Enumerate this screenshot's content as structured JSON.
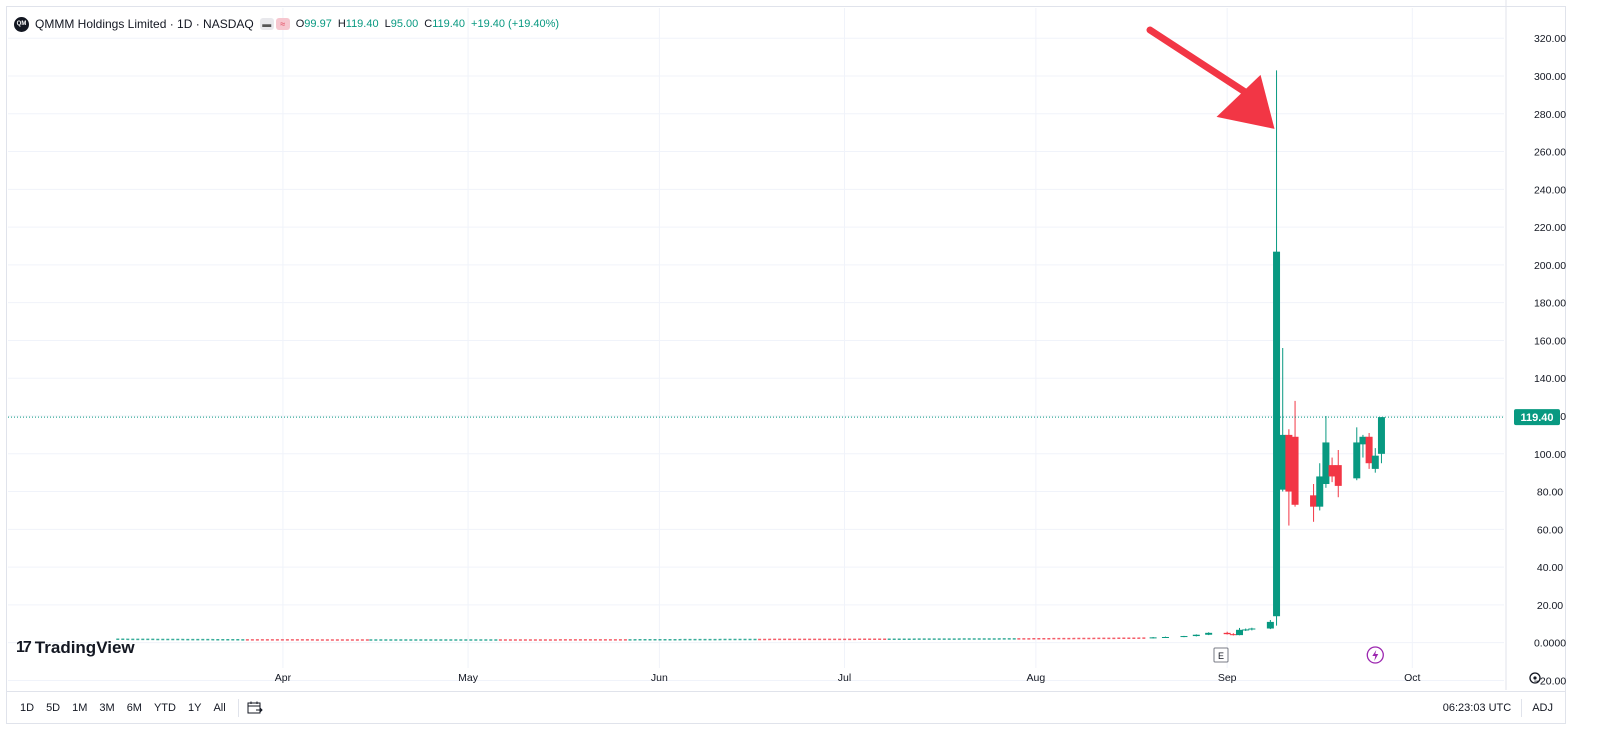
{
  "legend": {
    "logo_text": "QM",
    "title": "QMMM Holdings Limited · 1D · NASDAQ",
    "ohlc": [
      {
        "k": "O",
        "v": "99.97"
      },
      {
        "k": "H",
        "v": "119.40"
      },
      {
        "k": "L",
        "v": "95.00"
      },
      {
        "k": "C",
        "v": "119.40"
      },
      {
        "k": "",
        "v": "+19.40 (+19.40%)"
      }
    ]
  },
  "brand": {
    "name": "TradingView",
    "mark": "17"
  },
  "timeframes": [
    "1D",
    "5D",
    "1M",
    "3M",
    "6M",
    "YTD",
    "1Y",
    "All"
  ],
  "clock": "06:23:03 UTC",
  "adj": "ADJ",
  "markers": {
    "earnings": "E",
    "dividend_icon": "lightning-icon"
  },
  "colors": {
    "up": "#089981",
    "down": "#f23645",
    "annotation_arrow": "#f23645"
  },
  "chart_data": {
    "type": "candlestick",
    "symbol": "QMMM",
    "interval": "1D",
    "y_axis": {
      "ticks": [
        "320.00",
        "300.00",
        "280.00",
        "260.00",
        "240.00",
        "220.00",
        "200.00",
        "180.00",
        "160.00",
        "140.00",
        "120.00",
        "100.00",
        "80.00",
        "60.00",
        "40.00",
        "20.00",
        "0.0000",
        "−20.00"
      ],
      "range": [
        -24,
        336
      ],
      "position": "right"
    },
    "x_axis": {
      "ticks": [
        "Apr",
        "May",
        "Jun",
        "Jul",
        "Aug",
        "Sep",
        "Oct"
      ],
      "range": [
        "2025-03-15",
        "2025-10-05"
      ]
    },
    "last_price": {
      "value": 119.4,
      "label": "119.40"
    },
    "grid": true,
    "baseline": [
      {
        "d": "2025-03-05",
        "o": 1.8,
        "h": 2.0,
        "l": 1.6,
        "c": 1.8
      },
      {
        "d": "2025-03-26",
        "o": 1.6,
        "h": 1.8,
        "l": 1.4,
        "c": 1.5
      },
      {
        "d": "2025-04-15",
        "o": 1.4,
        "h": 1.6,
        "l": 1.3,
        "c": 1.4
      },
      {
        "d": "2025-05-06",
        "o": 1.3,
        "h": 1.5,
        "l": 1.2,
        "c": 1.4
      },
      {
        "d": "2025-05-27",
        "o": 1.4,
        "h": 1.6,
        "l": 1.3,
        "c": 1.5
      },
      {
        "d": "2025-06-17",
        "o": 1.5,
        "h": 1.7,
        "l": 1.4,
        "c": 1.7
      },
      {
        "d": "2025-07-08",
        "o": 1.7,
        "h": 1.9,
        "l": 1.6,
        "c": 1.8
      },
      {
        "d": "2025-07-29",
        "o": 1.8,
        "h": 2.1,
        "l": 1.7,
        "c": 2.0
      },
      {
        "d": "2025-08-19",
        "o": 2.0,
        "h": 2.5,
        "l": 1.9,
        "c": 2.4
      }
    ],
    "candles": [
      {
        "d": "2025-08-20",
        "o": 2.4,
        "h": 3.0,
        "l": 2.2,
        "c": 2.8
      },
      {
        "d": "2025-08-22",
        "o": 2.8,
        "h": 3.2,
        "l": 2.6,
        "c": 3.0
      },
      {
        "d": "2025-08-25",
        "o": 3.0,
        "h": 3.6,
        "l": 2.9,
        "c": 3.5
      },
      {
        "d": "2025-08-27",
        "o": 3.5,
        "h": 4.4,
        "l": 3.3,
        "c": 4.2
      },
      {
        "d": "2025-08-29",
        "o": 4.2,
        "h": 5.5,
        "l": 4.0,
        "c": 5.2
      },
      {
        "d": "2025-09-01",
        "o": 5.2,
        "h": 5.8,
        "l": 4.3,
        "c": 4.5
      },
      {
        "d": "2025-09-02",
        "o": 4.5,
        "h": 5.0,
        "l": 3.8,
        "c": 4.0
      },
      {
        "d": "2025-09-03",
        "o": 4.0,
        "h": 7.8,
        "l": 3.9,
        "c": 6.8
      },
      {
        "d": "2025-09-04",
        "o": 6.8,
        "h": 7.5,
        "l": 6.2,
        "c": 7.0
      },
      {
        "d": "2025-09-05",
        "o": 7.0,
        "h": 7.9,
        "l": 6.5,
        "c": 7.5
      },
      {
        "d": "2025-09-08",
        "o": 7.5,
        "h": 12.0,
        "l": 7.2,
        "c": 11.0
      },
      {
        "d": "2025-09-09",
        "o": 14.0,
        "h": 303.0,
        "l": 9.0,
        "c": 207.0
      },
      {
        "d": "2025-09-10",
        "o": 81.0,
        "h": 156.0,
        "l": 80.0,
        "c": 110.0
      },
      {
        "d": "2025-09-11",
        "o": 110.0,
        "h": 113.0,
        "l": 62.0,
        "c": 80.0
      },
      {
        "d": "2025-09-12",
        "o": 109.0,
        "h": 128.0,
        "l": 72.0,
        "c": 73.0
      },
      {
        "d": "2025-09-15",
        "o": 78.0,
        "h": 84.0,
        "l": 64.0,
        "c": 72.0
      },
      {
        "d": "2025-09-16",
        "o": 72.0,
        "h": 95.0,
        "l": 70.0,
        "c": 88.0
      },
      {
        "d": "2025-09-17",
        "o": 84.0,
        "h": 120.0,
        "l": 82.0,
        "c": 106.0
      },
      {
        "d": "2025-09-18",
        "o": 94.0,
        "h": 98.0,
        "l": 85.0,
        "c": 88.0
      },
      {
        "d": "2025-09-19",
        "o": 94.0,
        "h": 102.0,
        "l": 77.0,
        "c": 83.0
      },
      {
        "d": "2025-09-22",
        "o": 87.0,
        "h": 114.0,
        "l": 86.0,
        "c": 106.0
      },
      {
        "d": "2025-09-23",
        "o": 105.0,
        "h": 110.0,
        "l": 98.0,
        "c": 109.0
      },
      {
        "d": "2025-09-24",
        "o": 109.0,
        "h": 111.0,
        "l": 92.0,
        "c": 95.0
      },
      {
        "d": "2025-09-25",
        "o": 92.0,
        "h": 103.0,
        "l": 90.0,
        "c": 99.0
      },
      {
        "d": "2025-09-26",
        "o": 99.97,
        "h": 119.4,
        "l": 95.0,
        "c": 119.4
      }
    ],
    "annotations": [
      {
        "type": "arrow",
        "color": "#f23645",
        "points_to": {
          "d": "2025-09-09",
          "value": 272
        }
      }
    ]
  }
}
